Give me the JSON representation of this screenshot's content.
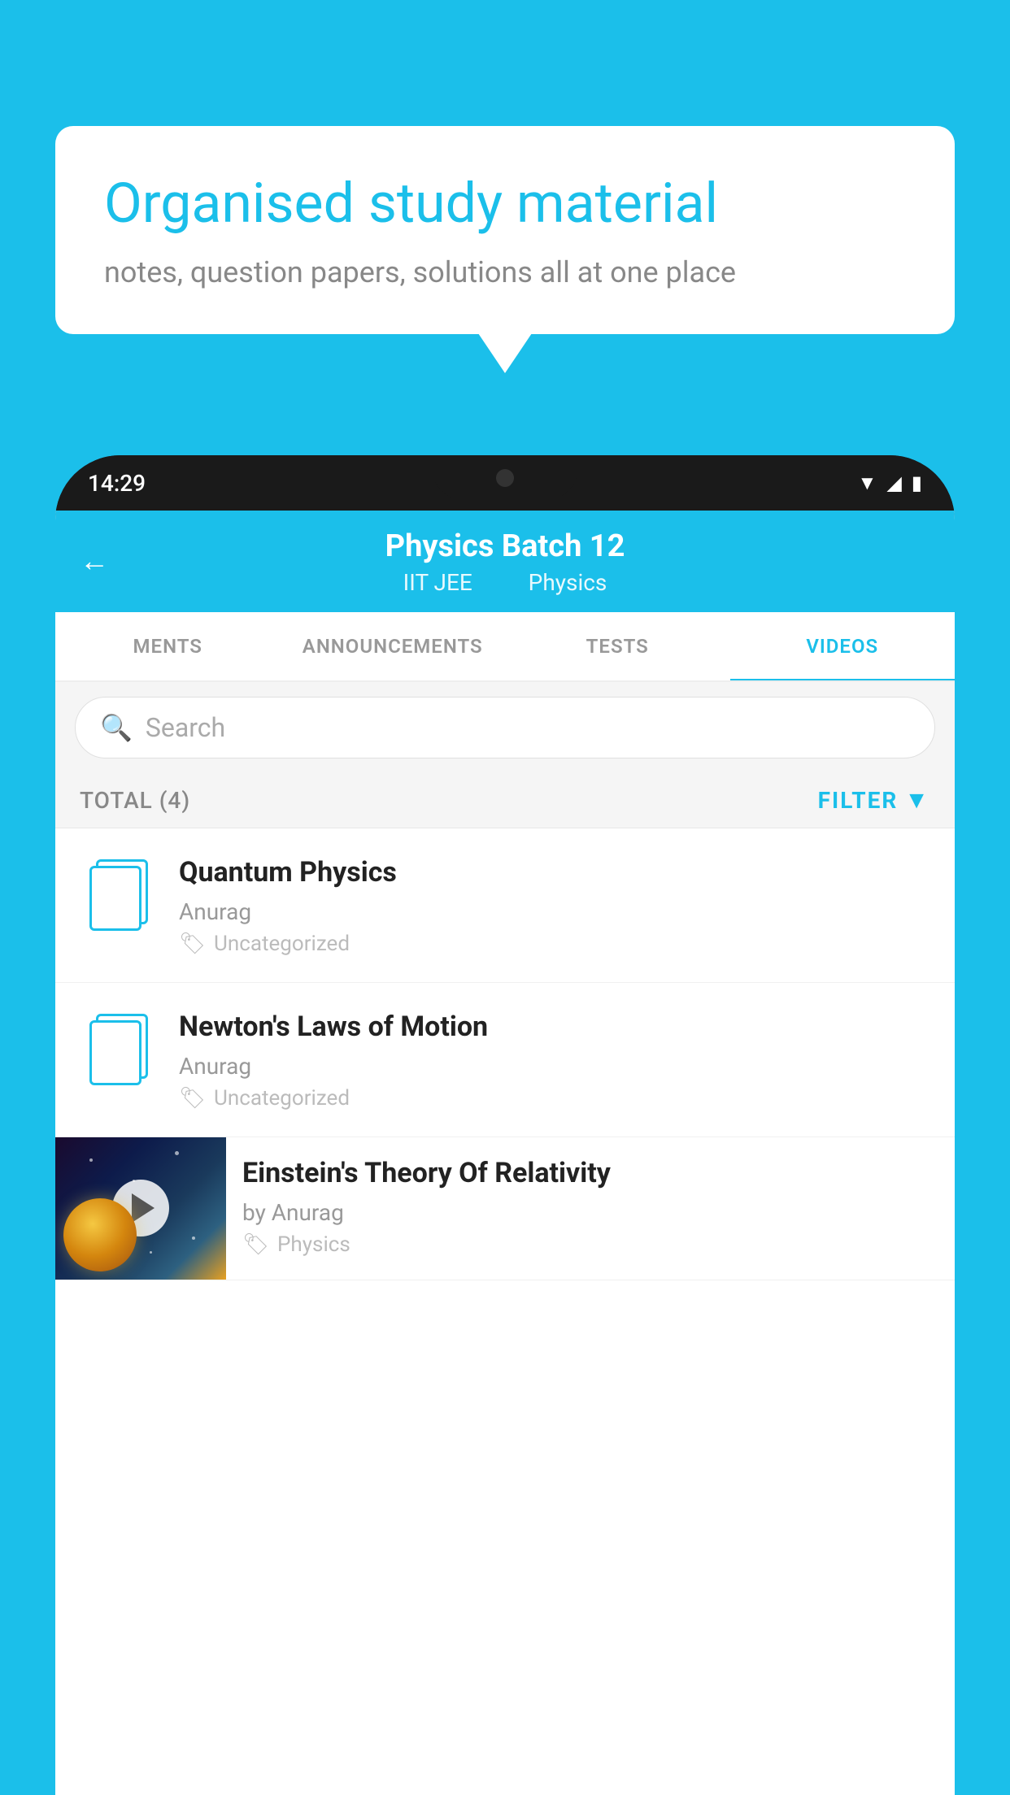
{
  "background_color": "#1BBFEA",
  "speech_bubble": {
    "title": "Organised study material",
    "subtitle": "notes, question papers, solutions all at one place"
  },
  "phone": {
    "time": "14:29",
    "header": {
      "back_label": "←",
      "title": "Physics Batch 12",
      "subtitle_part1": "IIT JEE",
      "subtitle_part2": "Physics"
    },
    "tabs": [
      {
        "label": "MENTS",
        "active": false
      },
      {
        "label": "ANNOUNCEMENTS",
        "active": false
      },
      {
        "label": "TESTS",
        "active": false
      },
      {
        "label": "VIDEOS",
        "active": true
      }
    ],
    "search": {
      "placeholder": "Search"
    },
    "filter_bar": {
      "total_label": "TOTAL (4)",
      "filter_label": "FILTER"
    },
    "videos": [
      {
        "id": 1,
        "title": "Quantum Physics",
        "author": "Anurag",
        "tag": "Uncategorized",
        "has_thumbnail": false
      },
      {
        "id": 2,
        "title": "Newton's Laws of Motion",
        "author": "Anurag",
        "tag": "Uncategorized",
        "has_thumbnail": false
      },
      {
        "id": 3,
        "title": "Einstein's Theory Of Relativity",
        "author": "by Anurag",
        "tag": "Physics",
        "has_thumbnail": true
      }
    ]
  }
}
